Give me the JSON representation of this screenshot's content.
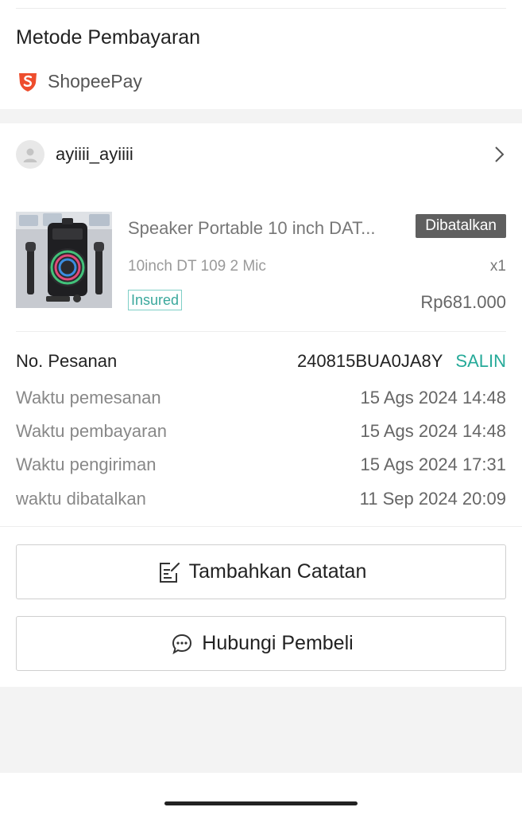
{
  "payment": {
    "title": "Metode Pembayaran",
    "method": "ShopeePay",
    "logo_icon": "shopeepay-logo",
    "brand_color": "#ee4d2d"
  },
  "buyer": {
    "username": "ayiiii_ayiiii",
    "avatar_icon": "user-avatar-icon",
    "chevron_icon": "chevron-right-icon"
  },
  "product": {
    "name": "Speaker Portable 10 inch DAT...",
    "status": "Dibatalkan",
    "variation": "10inch DT 109 2 Mic",
    "quantity": "x1",
    "badge": "Insured",
    "price": "Rp681.000"
  },
  "order": {
    "number_label": "No. Pesanan",
    "number_value": "240815BUA0JA8Y",
    "copy_label": "SALIN",
    "copy_color": "#26aa99",
    "rows": [
      {
        "label": "Waktu pemesanan",
        "value": "15 Ags 2024 14:48"
      },
      {
        "label": "Waktu pembayaran",
        "value": "15 Ags 2024 14:48"
      },
      {
        "label": "Waktu pengiriman",
        "value": "15 Ags 2024 17:31"
      },
      {
        "label": "waktu dibatalkan",
        "value": "11 Sep 2024 20:09"
      }
    ]
  },
  "actions": {
    "add_note": "Tambahkan Catatan",
    "add_note_icon": "note-edit-icon",
    "contact_buyer": "Hubungi Pembeli",
    "contact_buyer_icon": "chat-bubble-icon"
  }
}
